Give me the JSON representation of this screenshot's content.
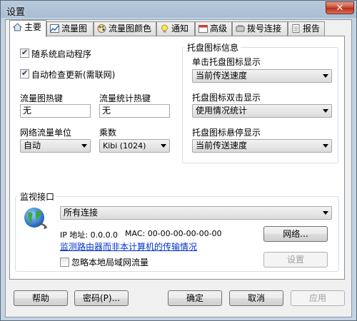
{
  "window": {
    "title": "设置",
    "close_glyph": "✕"
  },
  "tabs": [
    {
      "label": "主要",
      "icon": "home-icon"
    },
    {
      "label": "流量图",
      "icon": "chart-icon"
    },
    {
      "label": "流量图颜色",
      "icon": "palette-icon"
    },
    {
      "label": "通知",
      "icon": "bulb-icon"
    },
    {
      "label": "高级",
      "icon": "calendar-icon"
    },
    {
      "label": "拨号连接",
      "icon": "dial-icon"
    },
    {
      "label": "报告",
      "icon": "report-icon"
    }
  ],
  "main": {
    "autostart_label": "随系统启动程序",
    "autostart_checked": true,
    "autoupdate_label": "自动检查更新(需联网)",
    "autoupdate_checked": true,
    "graph_hotkey_label": "流量图热键",
    "graph_hotkey_value": "无",
    "stats_hotkey_label": "流量统计热键",
    "stats_hotkey_value": "无",
    "unit_label": "网络流量单位",
    "unit_value": "自动",
    "multiplier_label": "乘数",
    "multiplier_value": "Kibi (1024)",
    "tray": {
      "group_label": "托盘图标信息",
      "single_click_label": "单击托盘图标显示",
      "single_click_value": "当前传送速度",
      "double_click_label": "托盘图标双击显示",
      "double_click_value": "使用情况统计",
      "hover_label": "托盘图标悬停显示",
      "hover_value": "当前传送速度"
    },
    "monitor": {
      "group_label": "监视接口",
      "connection_value": "所有连接",
      "ip_text": "IP 地址: 0.0.0.0",
      "mac_text": "MAC: 00-00-00-00-00-00",
      "router_link": "监测路由器而非本计算机的传输情况",
      "network_button": "网络...",
      "settings_button": "设置",
      "ignore_lan_label": "忽略本地局域网流量",
      "ignore_lan_checked": false
    }
  },
  "footer": {
    "help": "帮助",
    "password": "密码(P)...",
    "ok": "确定",
    "cancel": "取消",
    "apply": "应用"
  }
}
